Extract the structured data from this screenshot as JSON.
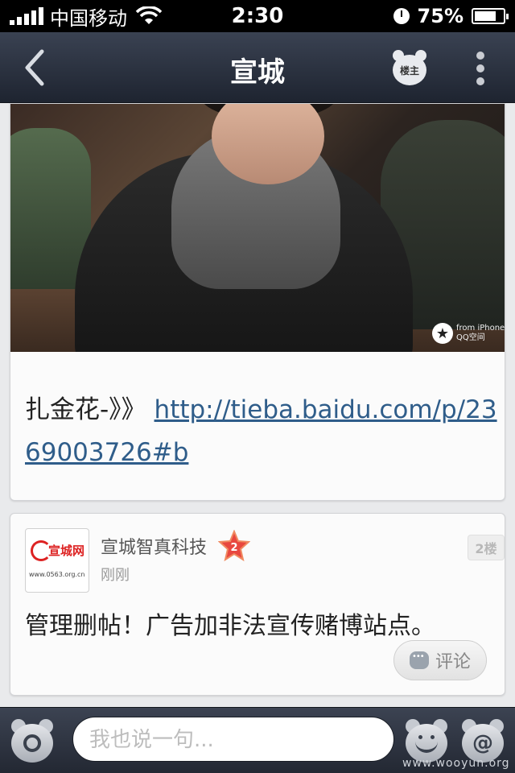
{
  "status_bar": {
    "carrier": "中国移动",
    "time": "2:30",
    "battery_percent": "75%",
    "battery_level": 0.75
  },
  "nav": {
    "title": "宣城",
    "owner_label": "楼主"
  },
  "post": {
    "text_prefix": "扎金花-》》",
    "link_text": "http://tieba.baidu.com/p/2369003726#b",
    "photo_watermark_line1": "from iPhone",
    "photo_watermark_line2": "QQ空间"
  },
  "reply": {
    "avatar_logo_text": "宣城网",
    "avatar_url_text": "www.0563.org.cn",
    "username": "宣城智真科技",
    "level": "2",
    "time": "刚刚",
    "floor": "2楼",
    "text": "管理删帖！广告加非法宣传赌博站点。",
    "comment_label": "评论"
  },
  "bottom_bar": {
    "input_placeholder": "我也说一句..."
  },
  "watermark": "www.wooyun.org",
  "colors": {
    "link": "#2f5d8a",
    "level_badge": "#e8473f",
    "nav_bg": "#2a303c"
  }
}
